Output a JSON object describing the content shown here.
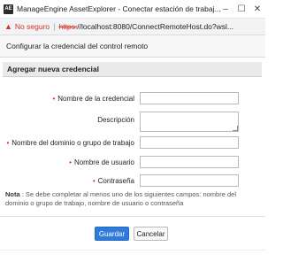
{
  "window": {
    "app_icon_text": "AE",
    "title": "ManageEngine AssetExplorer - Conectar estación de trabaj...",
    "controls": {
      "minimize": "–",
      "maximize": "☐",
      "close": "✕"
    }
  },
  "address_bar": {
    "security_label": "No seguro",
    "separator": "|",
    "url_scheme": "https:",
    "url_rest": "//localhost:8080/ConnectRemoteHost.do?wsl..."
  },
  "dialog": {
    "title": "Configurar la credencial del control remoto",
    "section_title": "Agregar nueva credencial",
    "fields": {
      "credential_name": {
        "label": "Nombre de la credencial",
        "value": "",
        "required": "•"
      },
      "description": {
        "label": "Descripción",
        "value": ""
      },
      "domain": {
        "label": "Nombre del dominio o grupo de trabajo",
        "value": "",
        "required": "•"
      },
      "username": {
        "label": "Nombre de usuario",
        "value": "",
        "required": "•"
      },
      "password": {
        "label": "Contraseña",
        "value": "",
        "required": "•"
      }
    },
    "note_label": "Nota",
    "note_text": ": Se debe completar al menos uno de los siguientes campos: nombre del dominio o grupo de trabajo, nombre de usuario o contraseña",
    "buttons": {
      "save": "Guardar",
      "cancel": "Cancelar"
    }
  },
  "colors": {
    "primary_button": "#2e7bd9",
    "required_marker": "#d32f2f",
    "insecure": "#d93025"
  }
}
